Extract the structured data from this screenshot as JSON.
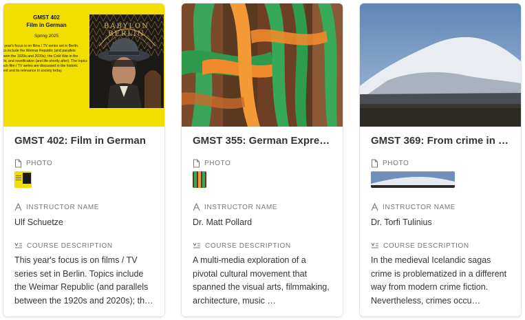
{
  "cards": [
    {
      "title": "GMST 402: Film in German",
      "photo_label": "PHOTO",
      "instructor_label": "INSTRUCTOR NAME",
      "instructor": "Ulf Schuetze",
      "description_label": "COURSE DESCRIPTION",
      "description": "This year's focus is on films / TV series set in Berlin. Topics include the Weimar Republic (and parallels between the 1920s and 2020s); the Cold War in the 1980s; and reunification (and life shortly after).",
      "cover": {
        "title": "GMST 402",
        "subtitle": "Film in German",
        "term": "Spring 2025",
        "body": "This year's focus is on films / TV series set in Berlin. Topics include the Weimar Republic (and parallels between the 1920s and 2020s); the Cold War in the 1980s; and reunification (and life shortly after). The topics of each film / TV series are discussed in the historic context and its relevance in society today.",
        "poster_text": "BABYLON BERLIN"
      }
    },
    {
      "title": "GMST 355: German Expre…",
      "photo_label": "PHOTO",
      "instructor_label": "INSTRUCTOR NAME",
      "instructor": "Dr. Matt Pollard",
      "description_label": "COURSE DESCRIPTION",
      "description": "A multi-media exploration of a pivotal cultural movement that spanned the visual arts, filmmaking, architecture, music …"
    },
    {
      "title": "GMST 369: From crime in …",
      "photo_label": "PHOTO",
      "instructor_label": "INSTRUCTOR NAME",
      "instructor": "Dr. Torfi Tulinius",
      "description_label": "COURSE DESCRIPTION",
      "description": "In the medieval Icelandic sagas crime is problematized in a different way from modern crime fiction. Nevertheless, crimes occu…"
    }
  ],
  "colors": {
    "cover_yellow": "#f2df00",
    "label_gray": "#787774",
    "text": "#37352f"
  },
  "icons": {
    "photo": "file-icon",
    "instructor": "text-a-icon",
    "description": "text-lines-icon"
  }
}
